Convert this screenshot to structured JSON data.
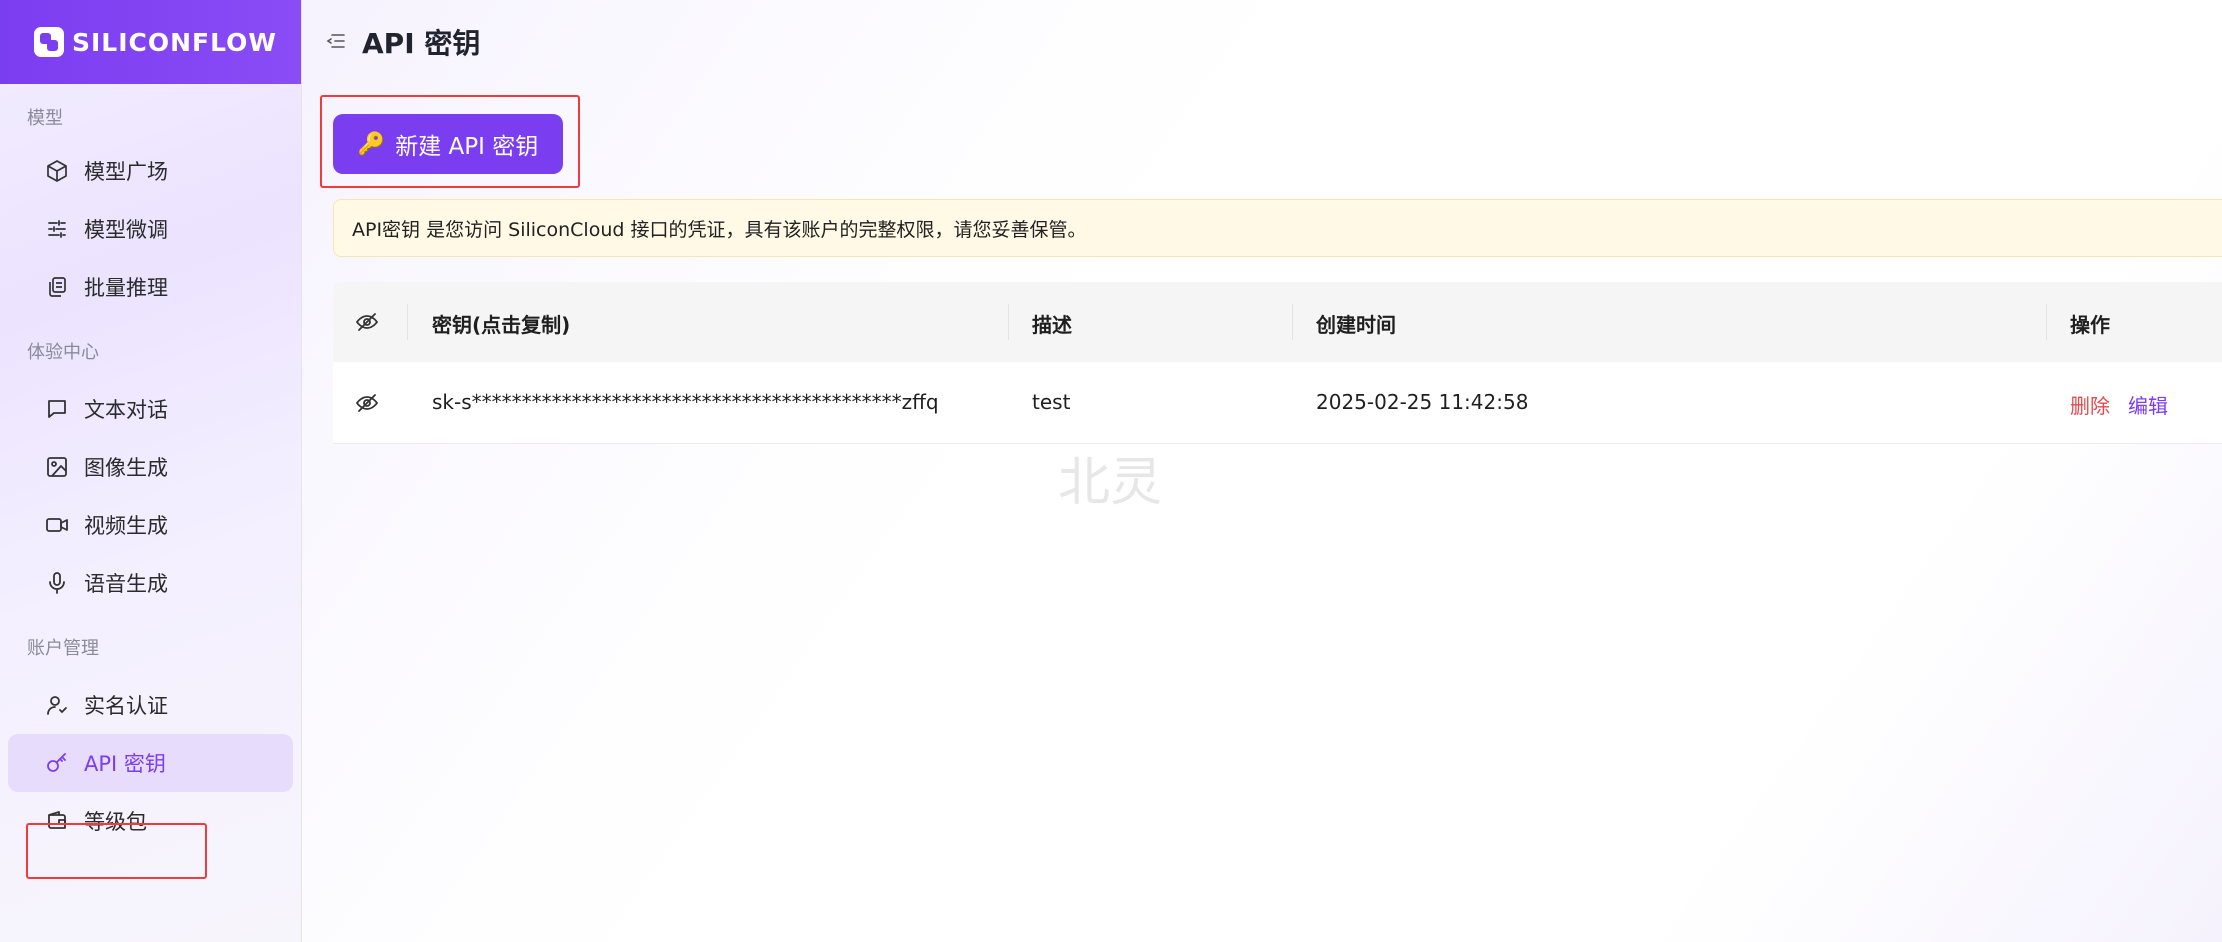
{
  "brand": {
    "name": "SILICONFLOW"
  },
  "sidebar": {
    "sections": [
      {
        "title": "模型",
        "items": [
          {
            "label": "模型广场",
            "icon": "cube-icon"
          },
          {
            "label": "模型微调",
            "icon": "sliders-icon"
          },
          {
            "label": "批量推理",
            "icon": "copy-stack-icon"
          }
        ]
      },
      {
        "title": "体验中心",
        "items": [
          {
            "label": "文本对话",
            "icon": "chat-bubble-icon"
          },
          {
            "label": "图像生成",
            "icon": "image-icon"
          },
          {
            "label": "视频生成",
            "icon": "video-camera-icon"
          },
          {
            "label": "语音生成",
            "icon": "microphone-icon"
          }
        ]
      },
      {
        "title": "账户管理",
        "items": [
          {
            "label": "实名认证",
            "icon": "user-check-icon"
          },
          {
            "label": "API 密钥",
            "icon": "key-icon",
            "active": true
          },
          {
            "label": "等级包",
            "icon": "wallet-icon"
          }
        ]
      }
    ]
  },
  "header": {
    "title": "API 密钥"
  },
  "toolbar": {
    "new_key_label": "新建 API 密钥",
    "key_emoji": "🔑"
  },
  "notice": {
    "text": "API密钥 是您访问 SiliconCloud 接口的凭证，具有该账户的完整权限，请您妥善保管。"
  },
  "table": {
    "headers": {
      "key": "密钥(点击复制)",
      "description": "描述",
      "created": "创建时间",
      "actions": "操作"
    },
    "rows": [
      {
        "key": "sk-s*******************************************zffq",
        "description": "test",
        "created": "2025-02-25 11:42:58",
        "delete_label": "删除",
        "edit_label": "编辑"
      }
    ]
  },
  "watermark": "北灵",
  "colors": {
    "accent": "#7b3df0",
    "danger": "#e5484d",
    "notice_bg": "#fff9e6"
  }
}
